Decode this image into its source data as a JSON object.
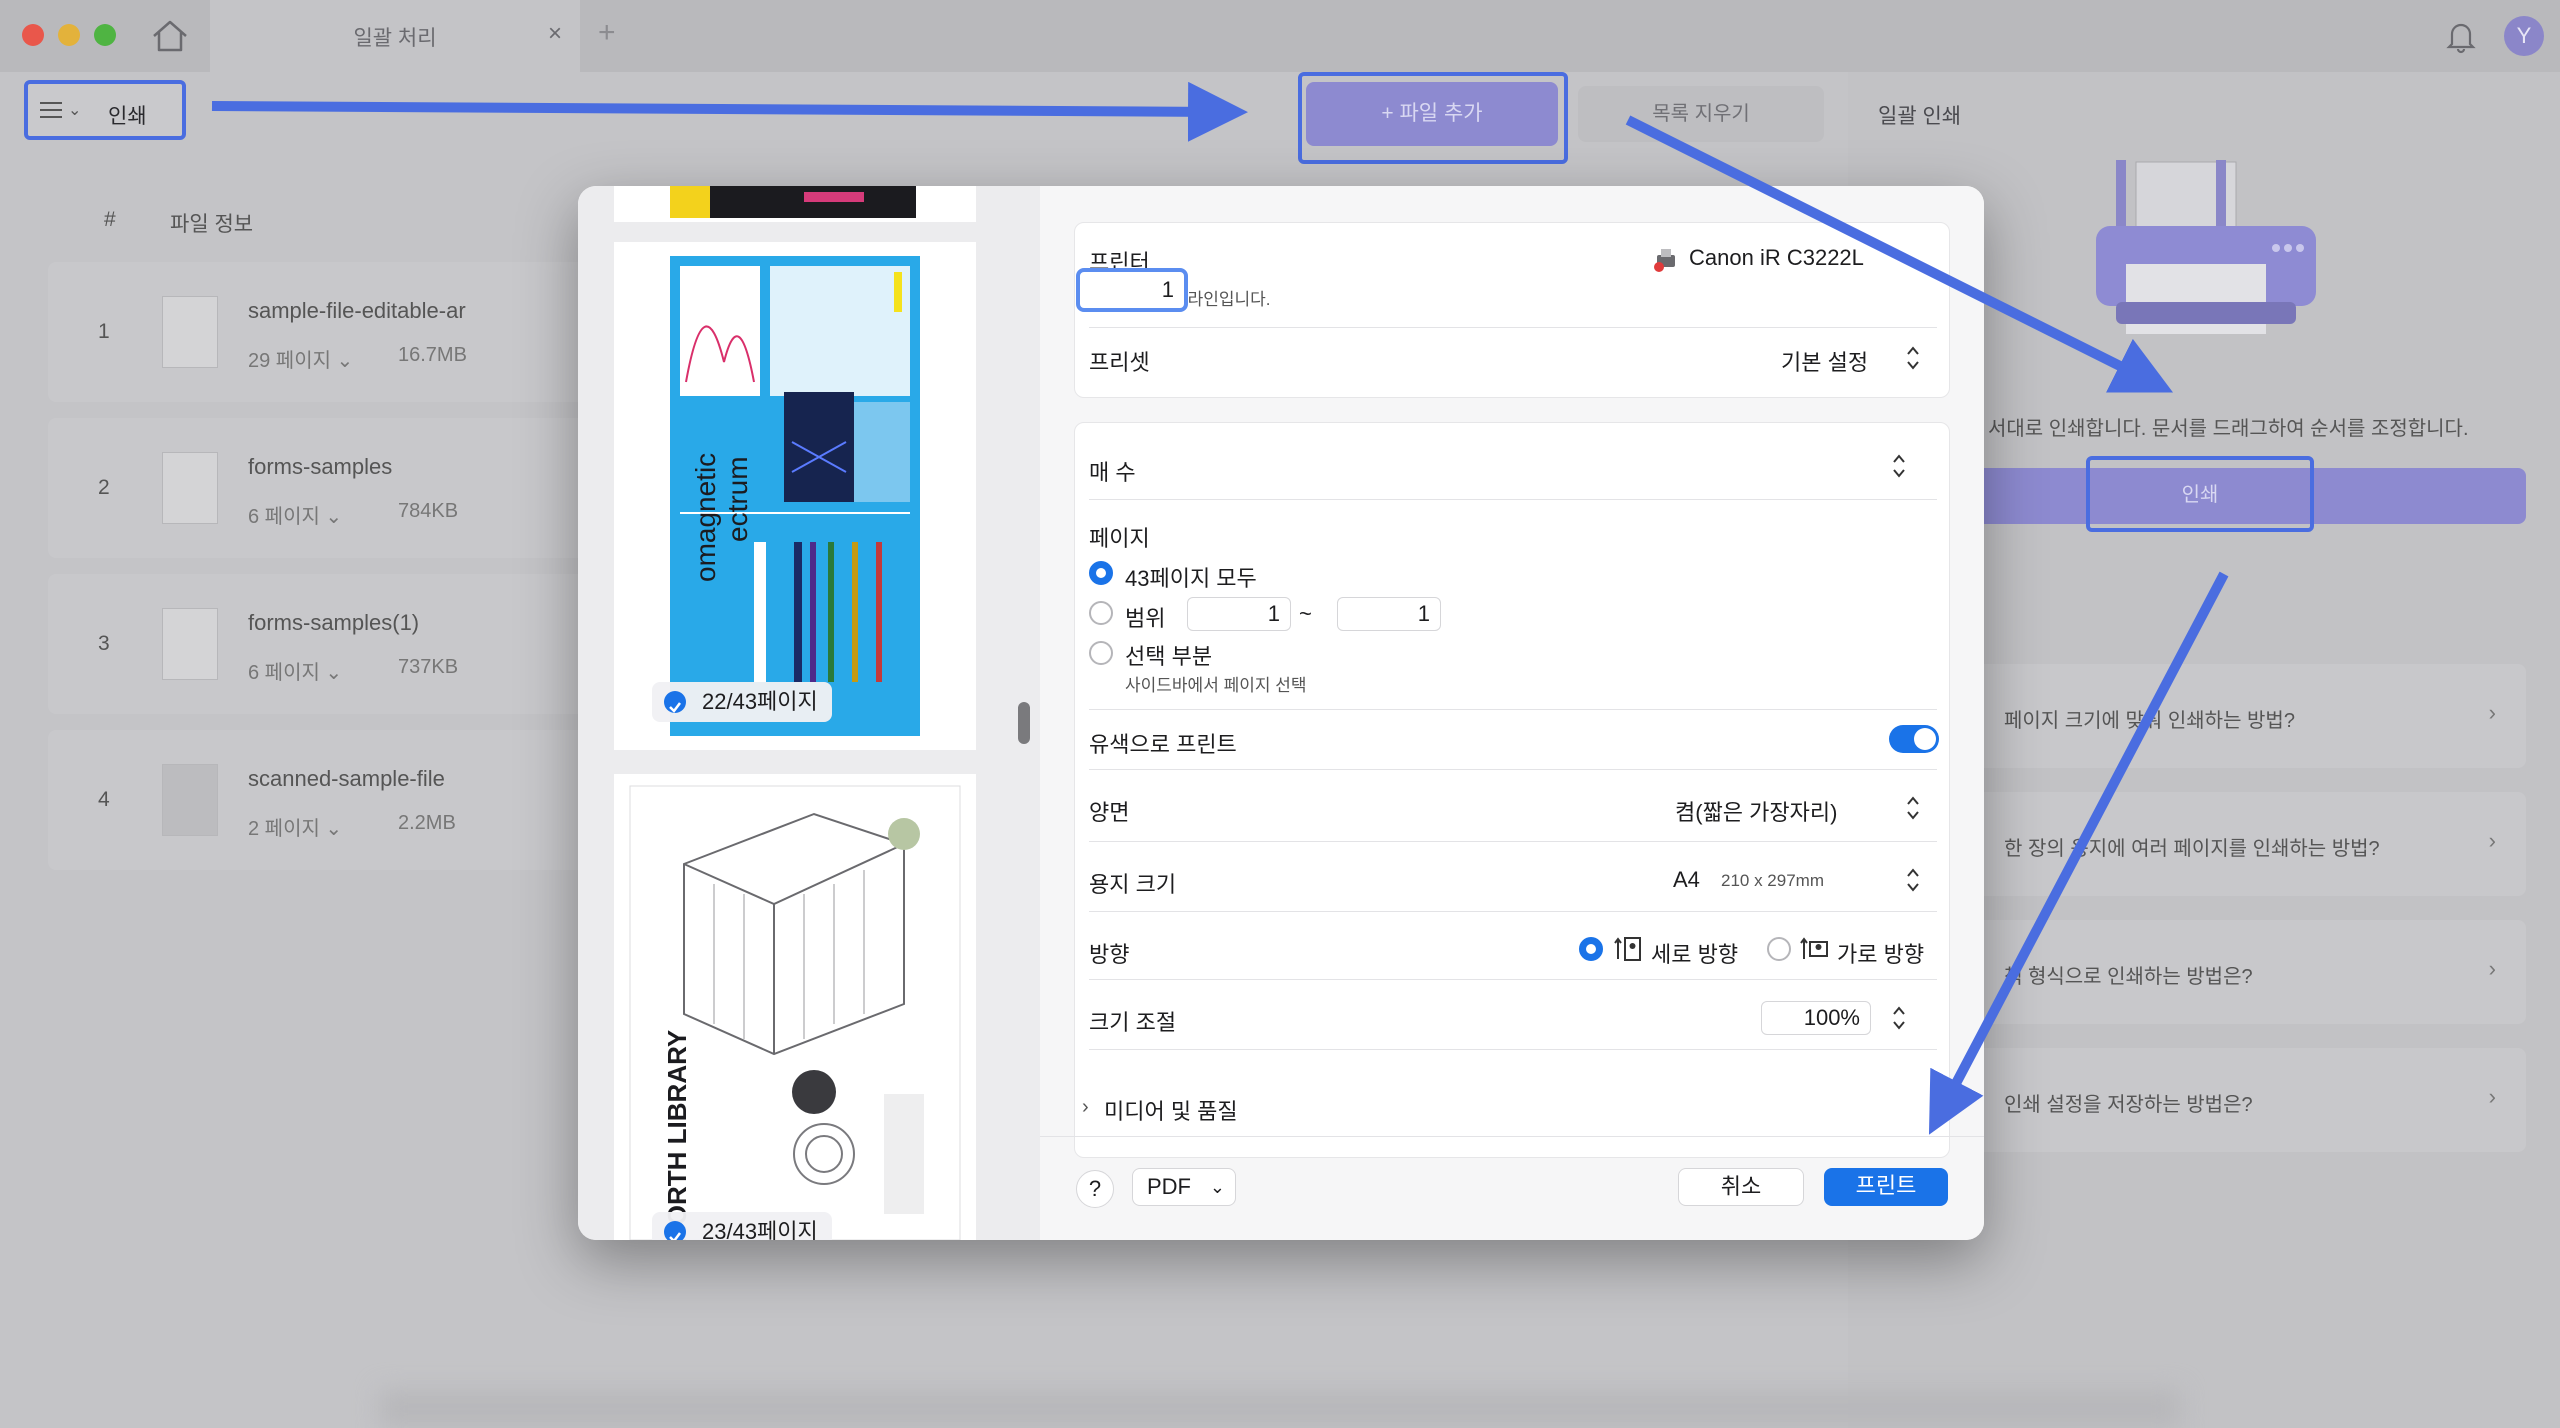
{
  "window": {
    "tab_title": "일괄 처리",
    "tab_close": "×",
    "tab_add": "+",
    "user_initial": "Y"
  },
  "toolbar": {
    "mode_label": "인쇄",
    "add_file_label": "+ 파일 추가",
    "clear_list_label": "목록 지우기"
  },
  "file_list": {
    "col_number": "#",
    "col_info": "파일 정보",
    "files": [
      {
        "num": "1",
        "name": "sample-file-editable-ar",
        "pages": "29 페이지 ⌄",
        "size": "16.7MB"
      },
      {
        "num": "2",
        "name": "forms-samples",
        "pages": "6 페이지 ⌄",
        "size": "784KB"
      },
      {
        "num": "3",
        "name": "forms-samples(1)",
        "pages": "6 페이지 ⌄",
        "size": "737KB"
      },
      {
        "num": "4",
        "name": "scanned-sample-file",
        "pages": "2 페이지 ⌄",
        "size": "2.2MB"
      }
    ]
  },
  "right_panel": {
    "title": "일괄 인쇄",
    "description": "서대로 인쇄합니다. 문서를 드래그하여 순서를 조정합니다.",
    "print_button": "인쇄",
    "faq": [
      "페이지 크기에 맞춰 인쇄하는 방법?",
      "한 장의 용지에 여러 페이지를 인쇄하는 방법?",
      "책 형식으로 인쇄하는 방법은?",
      "인쇄 설정을 저장하는 방법은?"
    ],
    "faq_chevron": "›"
  },
  "dialog": {
    "preview": {
      "page_a_badge": "22/43페이지",
      "page_b_badge": "23/43페이지",
      "page_a_text_1": "omagnetic",
      "page_a_text_2": "ectrum",
      "page_b_text": "NORTH LIBRARY"
    },
    "printer_label": "프린터",
    "printer_name": "Canon iR C3222L",
    "printer_status": "프린터가 오프라인입니다.",
    "preset_label": "프리셋",
    "preset_value": "기본 설정",
    "copies_label": "매 수",
    "copies_value": "1",
    "pages_label": "페이지",
    "pages_all": "43페이지 모두",
    "pages_range": "범위",
    "range_from": "1",
    "range_sep": "~",
    "range_to": "1",
    "pages_selection": "선택 부분",
    "pages_selection_hint": "사이드바에서 페이지 선택",
    "color_label": "유색으로 프린트",
    "color_enabled": true,
    "duplex_label": "양면",
    "duplex_value": "켬(짧은 가장자리)",
    "paper_label": "용지 크기",
    "paper_value": "A4",
    "paper_dims": "210 x 297mm",
    "orientation_label": "방향",
    "orientation_portrait": "세로 방향",
    "orientation_landscape": "가로 방향",
    "scale_label": "크기 조절",
    "scale_value": "100%",
    "media_label": "미디어 및 품질",
    "help_label": "?",
    "pdf_label": "PDF",
    "cancel_label": "취소",
    "print_label": "프린트"
  },
  "colors": {
    "accent": "#1a73e8",
    "annotation": "#4a6de0",
    "brand_purple": "#8d8ad0"
  }
}
